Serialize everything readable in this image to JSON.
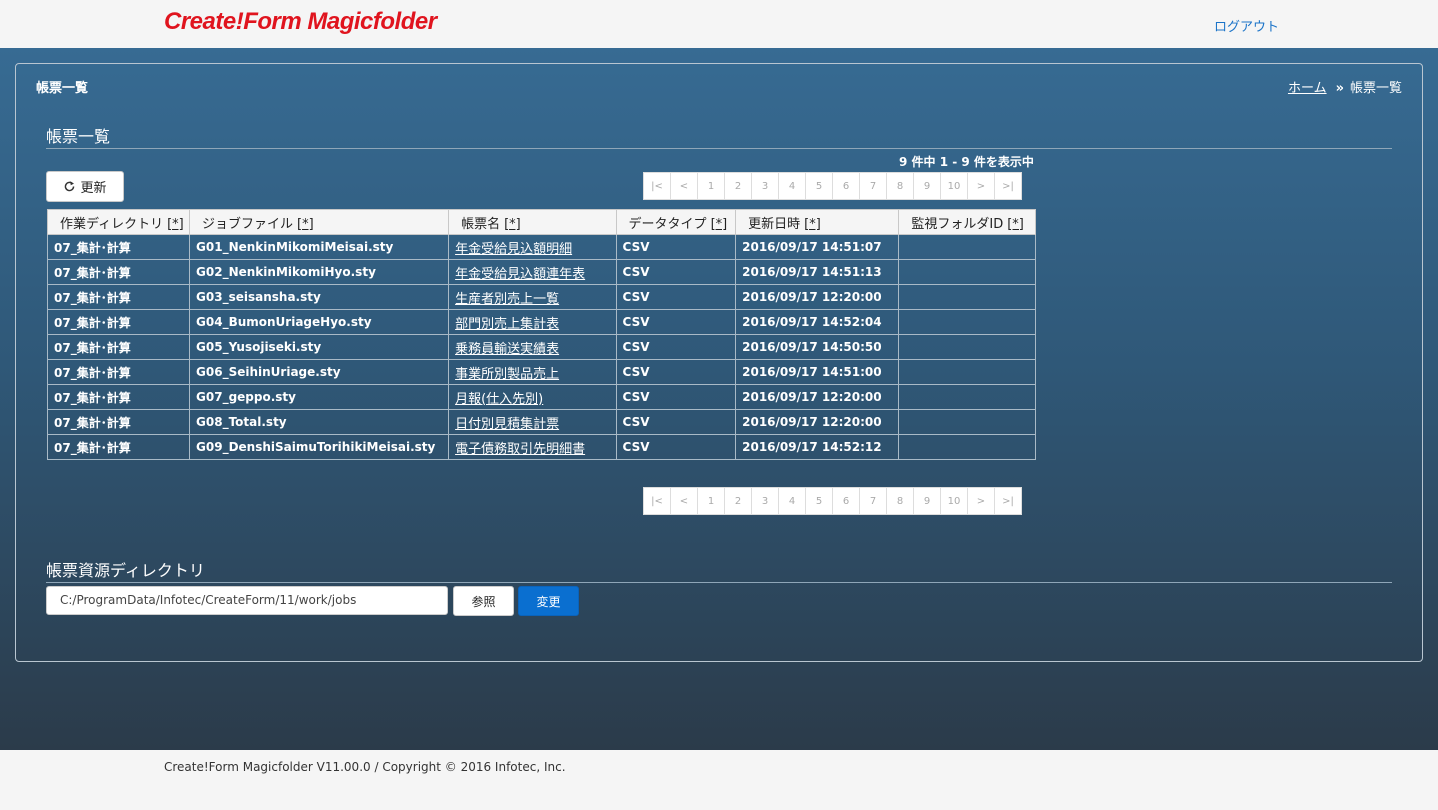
{
  "header": {
    "logo": "Create!Form Magicfolder",
    "logout": "ログアウト"
  },
  "panel": {
    "title": "帳票一覧",
    "breadcrumb": {
      "home": "ホーム",
      "separator": "»",
      "current": "帳票一覧"
    }
  },
  "list_section": {
    "heading": "帳票一覧",
    "count_text": "9 件中 1 - 9 件を表示中",
    "refresh_label": "更新",
    "pager": [
      "|<",
      "<",
      "1",
      "2",
      "3",
      "4",
      "5",
      "6",
      "7",
      "8",
      "9",
      "10",
      ">",
      ">|"
    ],
    "columns": [
      {
        "label": "作業ディレクトリ",
        "sort": "[*]"
      },
      {
        "label": "ジョブファイル",
        "sort": "[*]"
      },
      {
        "label": "帳票名",
        "sort": "[*]"
      },
      {
        "label": "データタイプ",
        "sort": "[*]"
      },
      {
        "label": "更新日時",
        "sort": "[*]"
      },
      {
        "label": "監視フォルダID",
        "sort": "[*]"
      }
    ],
    "rows": [
      [
        "07_集計･計算",
        "G01_NenkinMikomiMeisai.sty",
        "年金受給見込額明細",
        "CSV",
        "2016/09/17 14:51:07",
        ""
      ],
      [
        "07_集計･計算",
        "G02_NenkinMikomiHyo.sty",
        "年金受給見込額連年表",
        "CSV",
        "2016/09/17 14:51:13",
        ""
      ],
      [
        "07_集計･計算",
        "G03_seisansha.sty",
        "生産者別売上一覧",
        "CSV",
        "2016/09/17 12:20:00",
        ""
      ],
      [
        "07_集計･計算",
        "G04_BumonUriageHyo.sty",
        "部門別売上集計表",
        "CSV",
        "2016/09/17 14:52:04",
        ""
      ],
      [
        "07_集計･計算",
        "G05_Yusojiseki.sty",
        "乗務員輸送実績表",
        "CSV",
        "2016/09/17 14:50:50",
        ""
      ],
      [
        "07_集計･計算",
        "G06_SeihinUriage.sty",
        "事業所別製品売上",
        "CSV",
        "2016/09/17 14:51:00",
        ""
      ],
      [
        "07_集計･計算",
        "G07_geppo.sty",
        "月報(仕入先別)",
        "CSV",
        "2016/09/17 12:20:00",
        ""
      ],
      [
        "07_集計･計算",
        "G08_Total.sty",
        "日付別見積集計票",
        "CSV",
        "2016/09/17 12:20:00",
        ""
      ],
      [
        "07_集計･計算",
        "G09_DenshiSaimuTorihikiMeisai.sty",
        "電子債務取引先明細書",
        "CSV",
        "2016/09/17 14:52:12",
        ""
      ]
    ]
  },
  "resource_section": {
    "heading": "帳票資源ディレクトリ",
    "path_value": "C:/ProgramData/Infotec/CreateForm/11/work/jobs",
    "browse_label": "参照",
    "change_label": "変更"
  },
  "footer": {
    "text": "Create!Form Magicfolder V11.00.0 / Copyright © 2016 Infotec, Inc."
  },
  "colors": {
    "logo": "#e0141e",
    "link": "#1a73c8",
    "primary_button": "#0a6fd0"
  }
}
